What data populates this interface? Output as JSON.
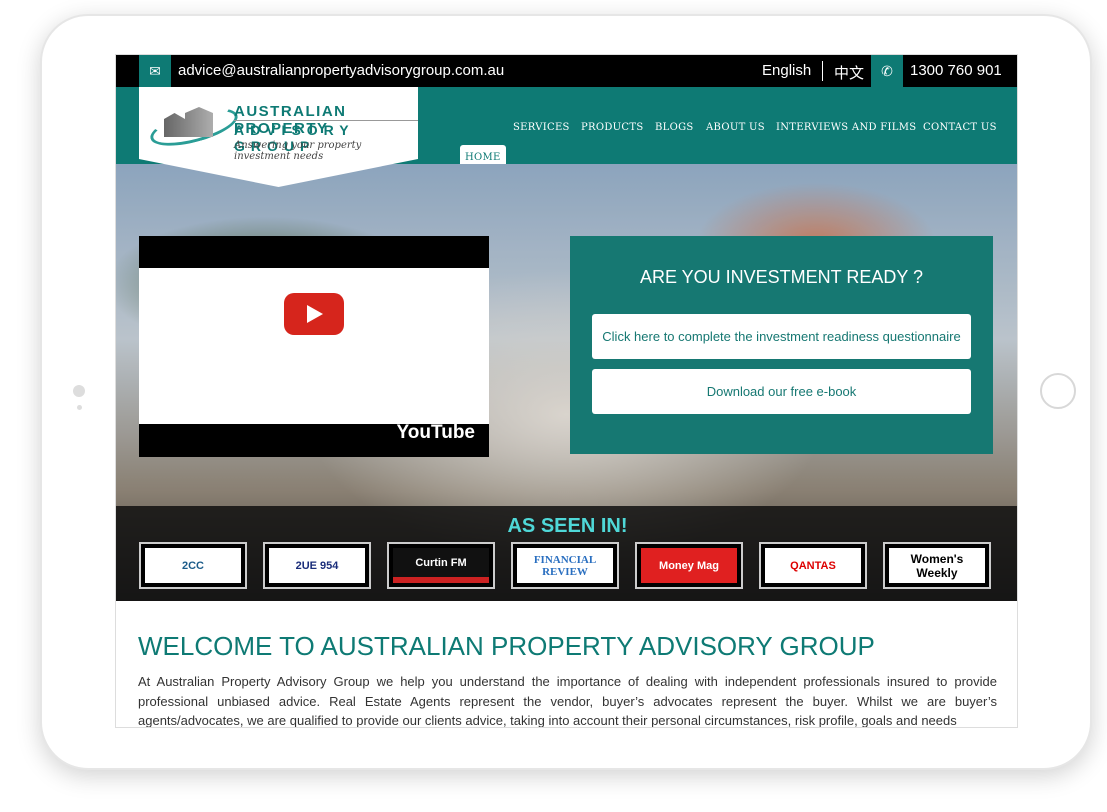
{
  "topbar": {
    "email": "advice@australianpropertyadvisorygroup.com.au",
    "language": "English",
    "language_alt": "中文",
    "phone": "1300 760 901"
  },
  "logo": {
    "line1": "AUSTRALIAN PROPERTY",
    "line2": "ADVISORY GROUP",
    "tagline": "Answering your property investment needs"
  },
  "nav": {
    "items": [
      "HOME",
      "SERVICES",
      "PRODUCTS",
      "BLOGS",
      "ABOUT US",
      "INTERVIEWS AND FILMS",
      "CONTACT US"
    ],
    "active": "HOME"
  },
  "video": {
    "brand": "YouTube"
  },
  "cta": {
    "title": "ARE YOU INVESTMENT READY ?",
    "button1": "Click here to complete the investment readiness questionnaire",
    "button2": "Download our free e-book"
  },
  "seen": {
    "title": "AS SEEN IN!",
    "logos": [
      "2CC",
      "2UE 954",
      "Curtin FM",
      "FINANCIAL REVIEW",
      "Money Mag",
      "QANTAS",
      "Women's Weekly"
    ]
  },
  "welcome": {
    "title": "WELCOME TO AUSTRALIAN PROPERTY ADVISORY GROUP",
    "text": "At Australian Property Advisory Group we help you understand the importance of dealing with independent professionals insured to provide professional unbiased advice. Real Estate Agents represent the vendor, buyer’s advocates represent the buyer. Whilst we are buyer’s agents/advocates, we are qualified to provide our clients advice, taking into account their personal circumstances, risk profile, goals and needs"
  },
  "colors": {
    "brand": "#0e7a74",
    "accent": "#4fd8d8"
  }
}
